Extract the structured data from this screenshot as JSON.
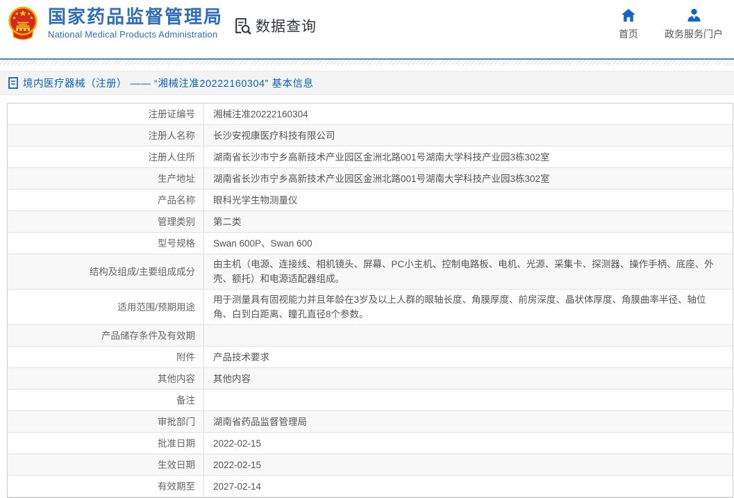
{
  "header": {
    "title_cn": "国家药品监督管理局",
    "title_en": "National Medical Products Administration",
    "data_query_label": "数据查询",
    "nav": [
      {
        "label": "首页"
      },
      {
        "label": "政务服务门户"
      }
    ]
  },
  "breadcrumb": {
    "text": "境内医疗器械（注册） —— “湘械注准20222160304” 基本信息"
  },
  "table": {
    "rows": [
      {
        "label": "注册证编号",
        "value": "湘械注准20222160304"
      },
      {
        "label": "注册人名称",
        "value": "长沙安视康医疗科技有限公司"
      },
      {
        "label": "注册人住所",
        "value": "湖南省长沙市宁乡高新技术产业园区金洲北路001号湖南大学科技产业园3栋302室"
      },
      {
        "label": "生产地址",
        "value": "湖南省长沙市宁乡高新技术产业园区金洲北路001号湖南大学科技产业园3栋302室"
      },
      {
        "label": "产品名称",
        "value": "眼科光学生物测量仪"
      },
      {
        "label": "管理类别",
        "value": "第二类"
      },
      {
        "label": "型号规格",
        "value": "Swan 600P、Swan 600"
      },
      {
        "label": "结构及组成/主要组成成分",
        "value": "由主机（电源、连接线、相机镜头、屏幕、PC小主机、控制电路板、电机、光源、采集卡、探测器、操作手柄、底座、外壳、额托）和电源适配器组成。"
      },
      {
        "label": "适用范围/预期用途",
        "value": "用于测量具有固视能力并且年龄在3岁及以上人群的眼轴长度、角膜厚度、前房深度、晶状体厚度、角膜曲率半径、轴位角、白到白距离、瞳孔直径8个参数。"
      },
      {
        "label": "产品储存条件及有效期",
        "value": ""
      },
      {
        "label": "附件",
        "value": "产品技术要求"
      },
      {
        "label": "其他内容",
        "value": "其他内容"
      },
      {
        "label": "备注",
        "value": ""
      },
      {
        "label": "审批部门",
        "value": "湖南省药品监督管理局"
      },
      {
        "label": "批准日期",
        "value": "2022-02-15"
      },
      {
        "label": "生效日期",
        "value": "2022-02-15"
      },
      {
        "label": "有效期至",
        "value": "2027-02-14"
      }
    ]
  },
  "colors": {
    "brand_blue": "#2f6db8",
    "link_blue": "#0c64be",
    "icon_blue": "#1464c8",
    "emblem_red": "#d5281e",
    "emblem_gold": "#f2c200",
    "alt_row_bg": "#f8f8f8",
    "border_gray": "#cccccc"
  }
}
